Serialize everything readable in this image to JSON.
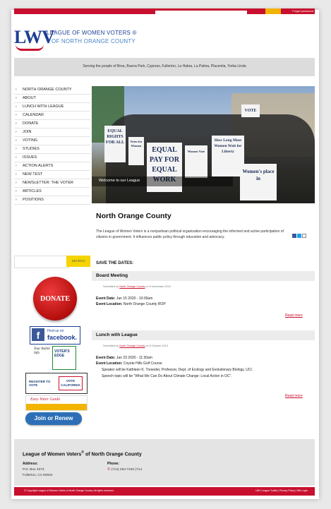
{
  "header": {
    "user_text": "Forgot password",
    "logo_mark": "LWV",
    "logo_line1": "LEAGUE OF WOMEN VOTERS ®",
    "logo_line2": "OF NORTH ORANGE COUNTY",
    "tagline": "Serving the people of Brea, Buena Park, Cypress, Fullerton, La Habra, La Palma, Placentia, Yorba Linda"
  },
  "sidebar": {
    "items": [
      {
        "label": "NORTH ORANGE COUNTY"
      },
      {
        "label": "ABOUT"
      },
      {
        "label": "LUNCH WITH LEAGUE"
      },
      {
        "label": "CALENDAR"
      },
      {
        "label": "DONATE"
      },
      {
        "label": "JOIN"
      },
      {
        "label": "VOTING"
      },
      {
        "label": "STUDIES"
      },
      {
        "label": "ISSUES"
      },
      {
        "label": "ACTION ALERTS"
      },
      {
        "label": "NEW TEST"
      },
      {
        "label": "NEWSLETTER: THE VOTER"
      },
      {
        "label": "ARTICLES"
      },
      {
        "label": "POSITIONS"
      }
    ],
    "search_button": "SEARCH",
    "search_placeholder": "",
    "donate_label": "DONATE",
    "facebook_small": "Find us on",
    "facebook_big": "facebook.",
    "voters_edge_tag": "Your Ballot Info",
    "voters_edge_name": "VOTER'S EDGE",
    "register_left": "REGISTER TO VOTE",
    "register_right": "VOTE CALIFORNIA",
    "easy_voter": "Easy Voter Guide",
    "join_label": "Join or Renew"
  },
  "hero": {
    "caption": "Welcome to our League",
    "signs": [
      "EQUAL RIGHTS FOR ALL",
      "Votes for Women",
      "EQUAL PAY FOR EQUAL WORK",
      "Women Vote",
      "How Long Must Women Wait for Liberty",
      "VOTE",
      "Women's place in"
    ]
  },
  "main": {
    "title": "North Orange County",
    "intro": "The League of Women Voters is a nonpartisan political organization encouraging the informed and active participation of citizens in government. It influences public policy through education and advocacy.",
    "save_dates": "SAVE THE DATES:",
    "events": [
      {
        "title": "Board Meeting",
        "submitted_prefix": "Submitted by",
        "submitted_by": "North Orange County",
        "submitted_suffix": "on 5 November 2019",
        "date_label": "Event Date:",
        "date": "Jan 15 2020 - 10:00am",
        "location_label": "Event Location:",
        "location": "North Orange County ROP",
        "read_more": "Read more"
      },
      {
        "title": "Lunch with League",
        "submitted_prefix": "Submitted by",
        "submitted_by": "North Orange County",
        "submitted_suffix": "on 8 October 2019",
        "date_label": "Event Date:",
        "date": "Jan 23 2020 - 11:30am",
        "location_label": "Event Location:",
        "location": "Coyote Hills Golf Course",
        "note1": "Speaker will be Kathleen K. Treseder, Professor, Dept. of Ecology and Evolutionary Biology, UCI.",
        "note2": "Speech topic will be \"What We Can Do About Climate Change: Local Action in OC\".",
        "read_more": "Read more"
      }
    ]
  },
  "footer": {
    "org_name": "League of Women Voters",
    "org_sup": "®",
    "org_suffix": " of North Orange County",
    "address_label": "Address:",
    "address_line1": "P.O. Box 3373",
    "address_line2": "Fullerton, CA 92834",
    "phone_label": "Phone:",
    "phone": "(714) 254-7440 (714",
    "copyright": "© Copyright League of Women Voters of North Orange County. All rights reserved.",
    "links": "LWV League Toolkit  |  Privacy Policy  |  Site Login"
  },
  "colors": {
    "brand_red": "#c8102e",
    "brand_blue": "#1c3f94",
    "search_yellow": "#f4d400"
  }
}
